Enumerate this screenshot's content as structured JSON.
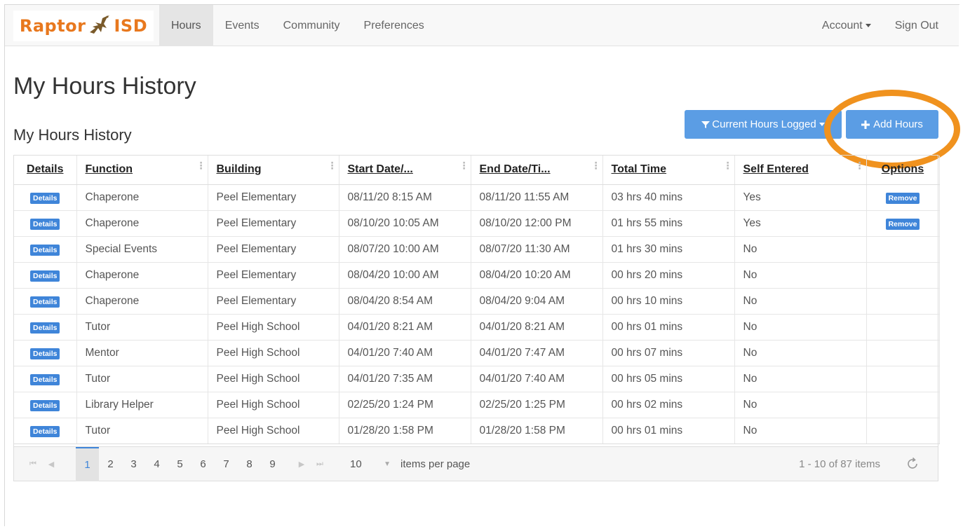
{
  "brand": {
    "text_left": "Raptor",
    "text_right": "ISD"
  },
  "nav": {
    "items": [
      {
        "label": "Hours"
      },
      {
        "label": "Events"
      },
      {
        "label": "Community"
      },
      {
        "label": "Preferences"
      }
    ],
    "account_label": "Account",
    "signout_label": "Sign Out"
  },
  "page": {
    "title": "My Hours History",
    "section_title": "My Hours History"
  },
  "toolbar": {
    "filter_label": "Current Hours Logged",
    "add_label": "Add Hours"
  },
  "table": {
    "headers": {
      "details": "Details",
      "function": "Function",
      "building": "Building",
      "start": "Start Date/...",
      "end": "End Date/Ti...",
      "total": "Total Time",
      "self": "Self Entered",
      "options": "Options"
    },
    "details_label": "Details",
    "remove_label": "Remove",
    "rows": [
      {
        "function": "Chaperone",
        "building": "Peel Elementary",
        "start": "08/11/20 8:15 AM",
        "end": "08/11/20 11:55 AM",
        "total": "03 hrs 40 mins",
        "self": "Yes",
        "remove": true
      },
      {
        "function": "Chaperone",
        "building": "Peel Elementary",
        "start": "08/10/20 10:05 AM",
        "end": "08/10/20 12:00 PM",
        "total": "01 hrs 55 mins",
        "self": "Yes",
        "remove": true
      },
      {
        "function": "Special Events",
        "building": "Peel Elementary",
        "start": "08/07/20 10:00 AM",
        "end": "08/07/20 11:30 AM",
        "total": "01 hrs 30 mins",
        "self": "No",
        "remove": false
      },
      {
        "function": "Chaperone",
        "building": "Peel Elementary",
        "start": "08/04/20 10:00 AM",
        "end": "08/04/20 10:20 AM",
        "total": "00 hrs 20 mins",
        "self": "No",
        "remove": false
      },
      {
        "function": "Chaperone",
        "building": "Peel Elementary",
        "start": "08/04/20 8:54 AM",
        "end": "08/04/20 9:04 AM",
        "total": "00 hrs 10 mins",
        "self": "No",
        "remove": false
      },
      {
        "function": "Tutor",
        "building": "Peel High School",
        "start": "04/01/20 8:21 AM",
        "end": "04/01/20 8:21 AM",
        "total": "00 hrs 01 mins",
        "self": "No",
        "remove": false
      },
      {
        "function": "Mentor",
        "building": "Peel High School",
        "start": "04/01/20 7:40 AM",
        "end": "04/01/20 7:47 AM",
        "total": "00 hrs 07 mins",
        "self": "No",
        "remove": false
      },
      {
        "function": "Tutor",
        "building": "Peel High School",
        "start": "04/01/20 7:35 AM",
        "end": "04/01/20 7:40 AM",
        "total": "00 hrs 05 mins",
        "self": "No",
        "remove": false
      },
      {
        "function": "Library Helper",
        "building": "Peel High School",
        "start": "02/25/20 1:24 PM",
        "end": "02/25/20 1:25 PM",
        "total": "00 hrs 02 mins",
        "self": "No",
        "remove": false
      },
      {
        "function": "Tutor",
        "building": "Peel High School",
        "start": "01/28/20 1:58 PM",
        "end": "01/28/20 1:58 PM",
        "total": "00 hrs 01 mins",
        "self": "No",
        "remove": false
      }
    ]
  },
  "pager": {
    "pages": [
      "1",
      "2",
      "3",
      "4",
      "5",
      "6",
      "7",
      "8",
      "9"
    ],
    "current": "1",
    "page_size": "10",
    "per_page_label": "items per page",
    "info": "1 - 10 of 87 items"
  },
  "colors": {
    "brand": "#e8781e",
    "primary": "#5b9de4",
    "tag": "#3f85d9",
    "highlight": "#f0921e"
  }
}
